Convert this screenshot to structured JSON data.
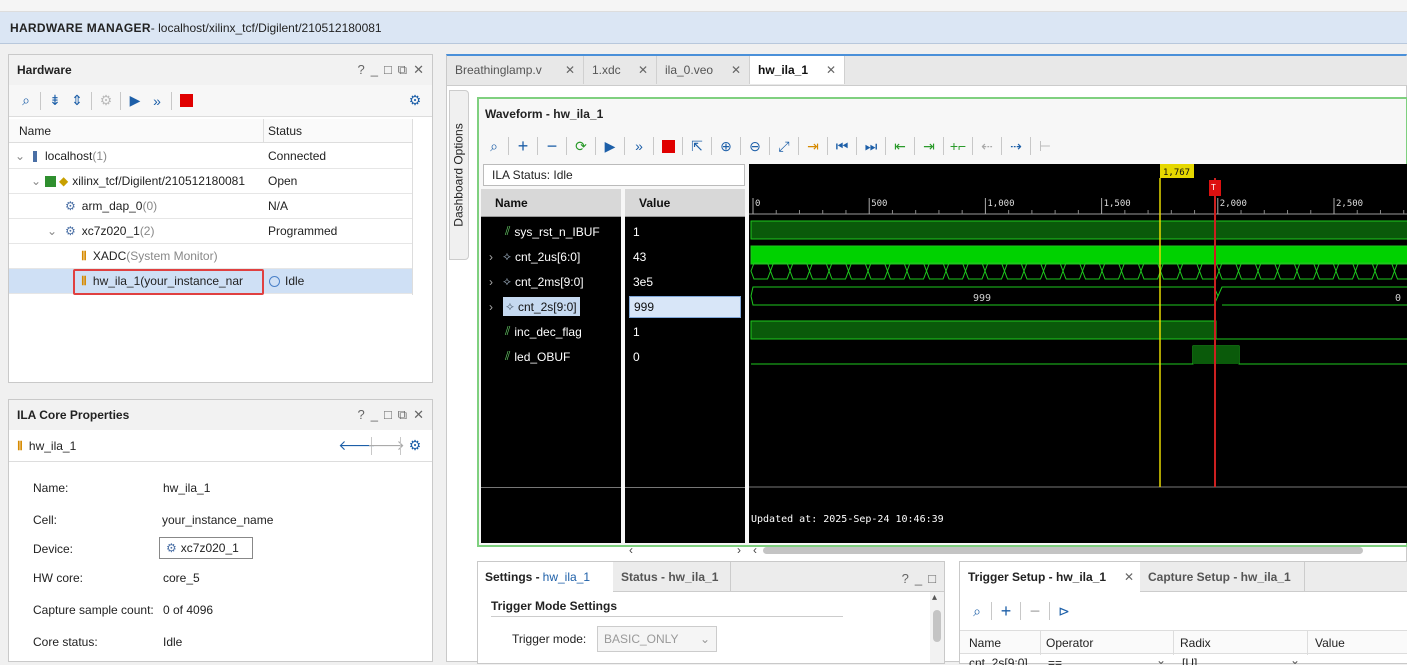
{
  "title_bar": {
    "app": "HARDWARE MANAGER",
    "path": " - localhost/xilinx_tcf/Digilent/210512180081"
  },
  "hardware_panel": {
    "title": "Hardware",
    "columns": [
      "Name",
      "Status"
    ],
    "rows": [
      {
        "name": "localhost",
        "count": " (1)",
        "status": "Connected"
      },
      {
        "name": "xilinx_tcf/Digilent/210512180081",
        "count": "",
        "status": "Open"
      },
      {
        "name": "arm_dap_0",
        "count": " (0)",
        "status": "N/A"
      },
      {
        "name": "xc7z020_1",
        "count": " (2)",
        "status": "Programmed"
      },
      {
        "name": "XADC",
        "count": " (System Monitor)",
        "status": ""
      },
      {
        "name": "hw_ila_1",
        "count": " (your_instance_nar",
        "status": "Idle"
      }
    ]
  },
  "ila_props": {
    "title": "ILA Core Properties",
    "core": "hw_ila_1",
    "labels": {
      "name": "Name:",
      "cell": "Cell:",
      "device": "Device:",
      "hw_core": "HW core:",
      "capture": "Capture sample count:",
      "status": "Core status:"
    },
    "values": {
      "name": "hw_ila_1",
      "cell": "your_instance_name",
      "device": "xc7z020_1",
      "hw_core": "core_5",
      "capture": "0 of 4096",
      "status": "Idle"
    }
  },
  "editor_tabs": [
    "Breathinglamp.v",
    "1.xdc",
    "ila_0.veo",
    "hw_ila_1"
  ],
  "dashboard_label": "Dashboard Options",
  "waveform": {
    "title": "Waveform - hw_ila_1",
    "ila_status": "ILA Status: Idle",
    "name_header": "Name",
    "value_header": "Value",
    "signals": [
      {
        "name": "sys_rst_n_IBUF",
        "value": "1"
      },
      {
        "name": "cnt_2us[6:0]",
        "value": "43"
      },
      {
        "name": "cnt_2ms[9:0]",
        "value": "3e5"
      },
      {
        "name": "cnt_2s[9:0]",
        "value": "999"
      },
      {
        "name": "inc_dec_flag",
        "value": "1"
      },
      {
        "name": "led_OBUF",
        "value": "0"
      }
    ],
    "ticks": [
      "0",
      "500",
      "1,000",
      "1,500",
      "2,000",
      "2,500"
    ],
    "marker": "1,767",
    "trigger_marker": "T",
    "bus_label_left": "999",
    "bus_label_right": "0",
    "updated": "Updated at: 2025-Sep-24 10:46:39"
  },
  "settings_panel": {
    "tab1_prefix": "Settings - ",
    "tab1_link": "hw_ila_1",
    "tab2": "Status - hw_ila_1",
    "section": "Trigger Mode Settings",
    "trigger_mode_label": "Trigger mode:",
    "trigger_mode_value": "BASIC_ONLY"
  },
  "trigger_panel": {
    "tab1": "Trigger Setup - hw_ila_1",
    "tab2": "Capture Setup - hw_ila_1",
    "columns": [
      "Name",
      "Operator",
      "Radix",
      "Value"
    ],
    "row": [
      "cnt_2s[9:0]",
      "==",
      "[U]"
    ]
  }
}
